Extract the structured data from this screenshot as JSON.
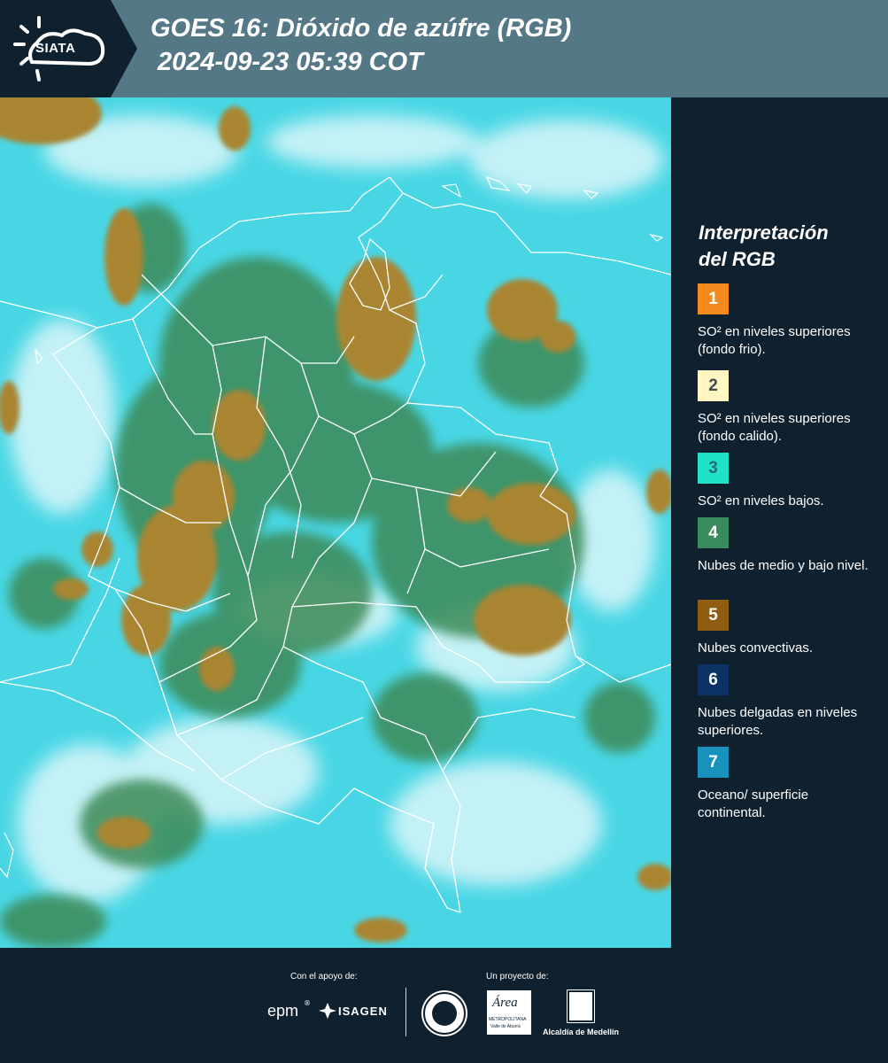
{
  "header": {
    "logo_label": "SIATA",
    "title": "GOES 16: Dióxido de azúfre (RGB)",
    "timestamp": "2024-09-23 05:39 COT",
    "bg_color": "#557887",
    "logo_bg_color": "#0f202e"
  },
  "legend": {
    "title_line1": "Interpretación",
    "title_line2": "del RGB",
    "items": [
      {
        "number": "1",
        "color": "#f58a1f",
        "number_color": "#ffffff",
        "label": "SO² en niveles superiores (fondo frio)."
      },
      {
        "number": "2",
        "color": "#fff6c4",
        "number_color": "#3d4a50",
        "label": "SO² en niveles superiores (fondo calido)."
      },
      {
        "number": "3",
        "color": "#1fe2c8",
        "number_color": "#2b6a70",
        "label": "SO² en niveles bajos."
      },
      {
        "number": "4",
        "color": "#3a8b5e",
        "number_color": "#ffffff",
        "label": "Nubes de medio y bajo nivel."
      },
      {
        "number": "5",
        "color": "#8f5d12",
        "number_color": "#ffffff",
        "label": "Nubes convectivas."
      },
      {
        "number": "6",
        "color": "#0d3266",
        "number_color": "#ffffff",
        "label": "Nubes delgadas en niveles superiores."
      },
      {
        "number": "7",
        "color": "#1891bd",
        "number_color": "#ffffff",
        "label": "Oceano/ superficie continental."
      }
    ]
  },
  "footer": {
    "support_caption": "Con el apoyo de:",
    "project_caption": "Un proyecto de:",
    "logo_epm": "epm",
    "logo_isagen": "ISAGEN",
    "logo_area": "Área",
    "logo_area_sub1": "METROPOLITANA",
    "logo_area_sub2": "Valle de Aburrá",
    "logo_alcaldia": "Alcaldía de Medellín"
  },
  "map": {
    "sea_color": "#48d6e4",
    "cloud_color": "#f2fbfd",
    "green_cloud_color": "#3d8a57",
    "convective_color": "#a98531",
    "border_color": "#ffffff"
  }
}
